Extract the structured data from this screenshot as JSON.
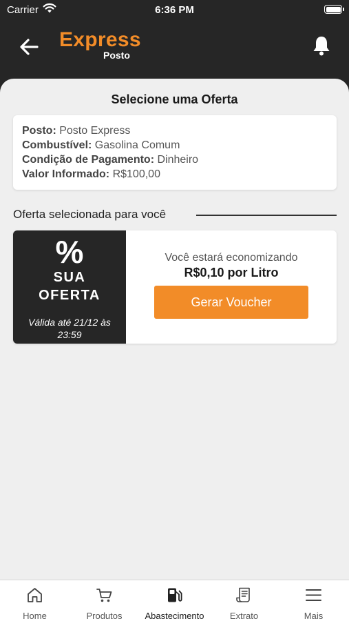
{
  "status_bar": {
    "carrier": "Carrier",
    "time": "6:36 PM"
  },
  "header": {
    "logo_line1": "Express",
    "logo_line2": "Posto",
    "brand_color": "#f28c28",
    "background_color": "#262626"
  },
  "page": {
    "title": "Selecione uma Oferta"
  },
  "info": {
    "posto_label": "Posto:",
    "posto_value": "Posto Express",
    "combustivel_label": "Combustível:",
    "combustivel_value": "Gasolina Comum",
    "pagamento_label": "Condição de Pagamento:",
    "pagamento_value": "Dinheiro",
    "valor_label": "Valor Informado:",
    "valor_value": "R$100,00"
  },
  "offer_section": {
    "title": "Oferta selecionada para você"
  },
  "offer": {
    "symbol": "%",
    "line1": "SUA",
    "line2": "OFERTA",
    "validity_line1": "Válida até 21/12 às",
    "validity_line2": "23:59",
    "description": "Você estará economizando",
    "amount": "R$0,10 por Litro",
    "button_label": "Gerar Voucher"
  },
  "tabbar": {
    "active": "Abastecimento",
    "items": [
      {
        "label": "Home",
        "icon": "home-icon"
      },
      {
        "label": "Produtos",
        "icon": "cart-icon"
      },
      {
        "label": "Abastecimento",
        "icon": "fuel-pump-icon"
      },
      {
        "label": "Extrato",
        "icon": "receipt-icon"
      },
      {
        "label": "Mais",
        "icon": "menu-icon"
      }
    ]
  }
}
